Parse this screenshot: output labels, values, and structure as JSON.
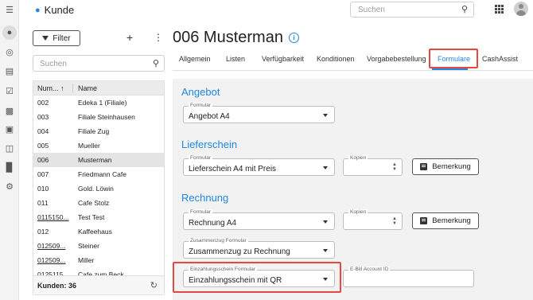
{
  "app": {
    "title": "Kunde",
    "search_placeholder": "Suchen",
    "accent_color": "#1e88e5",
    "highlight_color": "#e4493f"
  },
  "rail": {
    "icons": [
      "menu-icon",
      "user-circle-icon",
      "target-icon",
      "briefcase-icon",
      "cart-icon",
      "factory-icon",
      "money-icon",
      "clipboard-icon",
      "bar-chart-icon",
      "gear-icon"
    ]
  },
  "customer_list": {
    "filter_label": "Filter",
    "search_placeholder": "Suchen",
    "columns": {
      "number": "Num...",
      "name": "Name"
    },
    "rows": [
      {
        "number": "002",
        "name": "Edeka 1 (Filiale)"
      },
      {
        "number": "003",
        "name": "Filiale Steinhausen"
      },
      {
        "number": "004",
        "name": "Filiale Zug"
      },
      {
        "number": "005",
        "name": "Mueller"
      },
      {
        "number": "006",
        "name": "Musterman",
        "selected": true
      },
      {
        "number": "007",
        "name": "Friedmann Cafe"
      },
      {
        "number": "010",
        "name": "Gold. Löwin"
      },
      {
        "number": "011",
        "name": "Cafe Stolz"
      },
      {
        "number": "0115150...",
        "name": "Test Test",
        "link": true
      },
      {
        "number": "012",
        "name": "Kaffeehaus"
      },
      {
        "number": "012509...",
        "name": "Steiner",
        "link": true
      },
      {
        "number": "012509...",
        "name": "Miller",
        "link": true
      },
      {
        "number": "0125115...",
        "name": "Cafe zum Beck",
        "link": true
      }
    ],
    "footer": "Kunden: 36"
  },
  "customer": {
    "title": "006 Musterman",
    "tabs": [
      "Allgemein",
      "Listen",
      "Verfügbarkeit",
      "Konditionen",
      "Vorgabebestellung",
      "Formulare",
      "CashAssist"
    ],
    "active_tab": "Formulare"
  },
  "forms": {
    "angebot": {
      "heading": "Angebot",
      "formular_label": "Formular",
      "formular_value": "Angebot A4"
    },
    "lieferschein": {
      "heading": "Lieferschein",
      "formular_label": "Formular",
      "formular_value": "Lieferschein A4 mit Preis",
      "kopien_label": "Kopien",
      "kopien_value": "",
      "remark_label": "Bemerkung"
    },
    "rechnung": {
      "heading": "Rechnung",
      "formular_label": "Formular",
      "formular_value": "Rechnung A4",
      "kopien_label": "Kopien",
      "kopien_value": "",
      "remark_label": "Bemerkung",
      "zusammenzug_label": "Zusammenzug Formular",
      "zusammenzug_value": "Zusammenzug zu Rechnung",
      "einzahlung_label": "Einzahlungsschein Formular",
      "einzahlung_value": "Einzahlungsschein mit QR",
      "ebill_label": "E-Bill Account ID",
      "ebill_value": ""
    }
  }
}
